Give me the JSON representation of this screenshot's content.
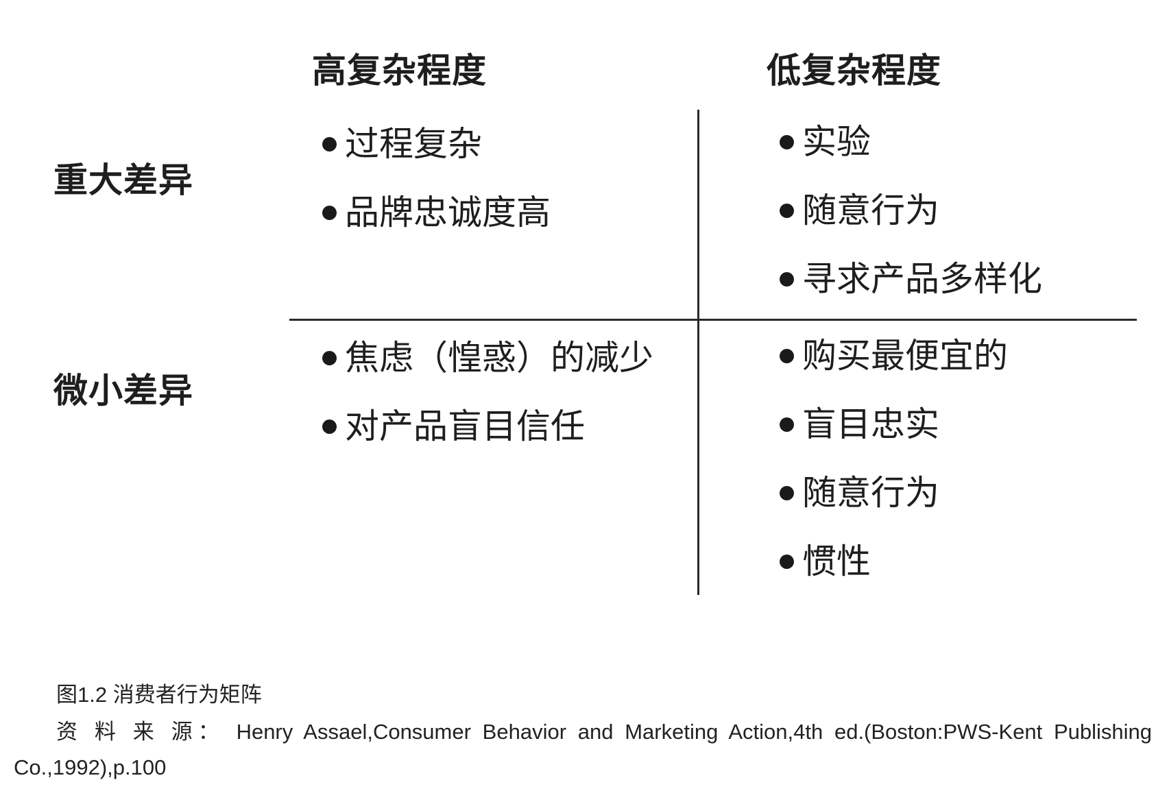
{
  "matrix": {
    "columns": {
      "high": "高复杂程度",
      "low": "低复杂程度"
    },
    "rows": {
      "significant": "重大差异",
      "minor": "微小差异"
    },
    "quadrants": {
      "significant_high": [
        "过程复杂",
        "品牌忠诚度高"
      ],
      "significant_low": [
        "实验",
        "随意行为",
        "寻求产品多样化"
      ],
      "minor_high": [
        "焦虑（惶惑）的减少",
        "对产品盲目信任"
      ],
      "minor_low": [
        "购买最便宜的",
        "盲目忠实",
        "随意行为",
        "惯性"
      ]
    }
  },
  "caption": {
    "title": "图1.2 消费者行为矩阵",
    "source": "资 料 来 源： Henry Assael,Consumer Behavior and Marketing Action,4th ed.(Boston:PWS-Kent Publishing Co.,1992),p.100"
  }
}
